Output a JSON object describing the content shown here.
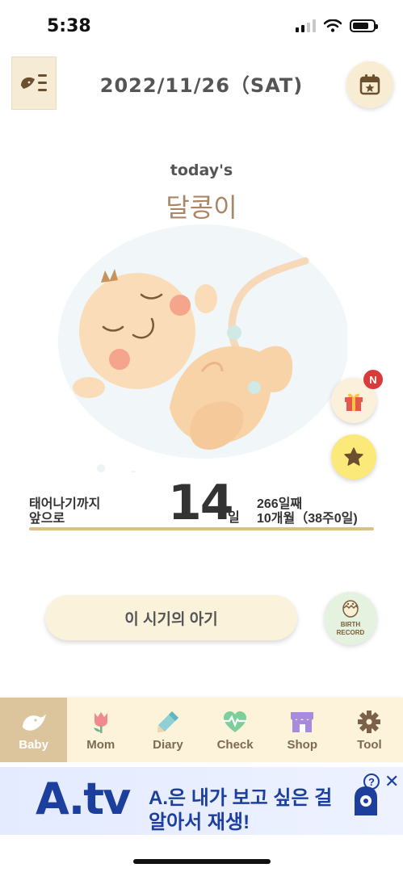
{
  "status": {
    "time": "5:38"
  },
  "header": {
    "date": "2022/11/26（SAT)"
  },
  "today": {
    "label": "today's",
    "name": "달콩이"
  },
  "countdown": {
    "left_line1": "태어나기까지",
    "left_line2": "앞으로",
    "number": "14",
    "unit": "일",
    "days": "266일째",
    "months": "10개월（38주0일)"
  },
  "badges": {
    "new": "N"
  },
  "period_button": "이 시기의 아기",
  "birth_record": {
    "line1": "BIRTH",
    "line2": "RECORD"
  },
  "nav": [
    {
      "label": "Baby",
      "icon": "baby-bird-icon"
    },
    {
      "label": "Mom",
      "icon": "tulip-icon"
    },
    {
      "label": "Diary",
      "icon": "pencil-icon"
    },
    {
      "label": "Check",
      "icon": "heartbeat-icon"
    },
    {
      "label": "Shop",
      "icon": "shop-icon"
    },
    {
      "label": "Tool",
      "icon": "gear-icon"
    }
  ],
  "ad": {
    "logo": "A.tv",
    "line1": "A.은 내가 보고 싶은 걸",
    "line2": "알아서 재생!",
    "info": "?",
    "close": "✕"
  },
  "colors": {
    "accent": "#dcc49c",
    "nav_bg": "#fdf3da",
    "name": "#a88667",
    "divider": "#d9c08a",
    "badge": "#d93a3a",
    "ad_text": "#1c3f9e"
  }
}
